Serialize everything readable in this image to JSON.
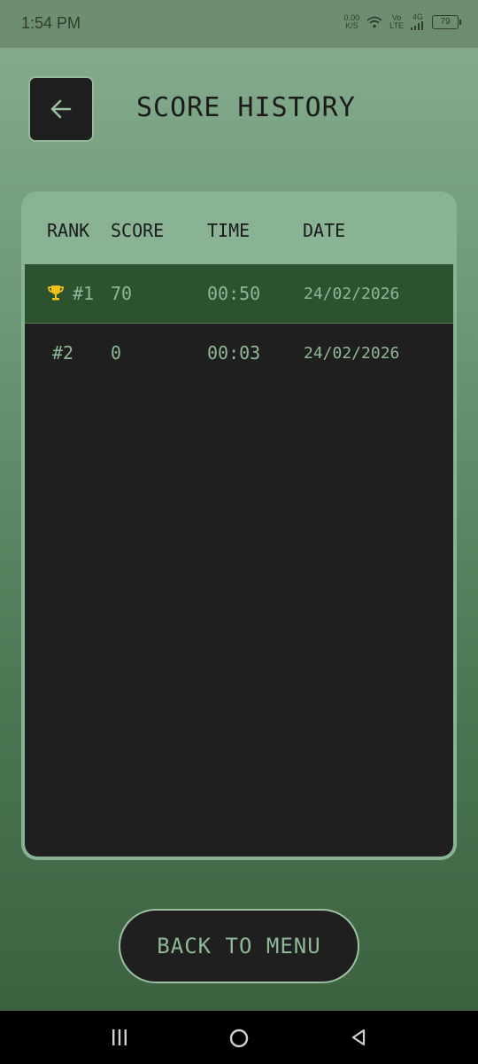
{
  "status_bar": {
    "time": "1:54 PM",
    "net_speed_value": "0.00",
    "net_speed_unit": "K/S",
    "volte_top": "Vo",
    "volte_bottom": "LTE",
    "network": "4G",
    "battery": "79"
  },
  "header": {
    "title": "SCORE HISTORY",
    "back_icon": "arrow-left-icon"
  },
  "table": {
    "columns": [
      "RANK",
      "SCORE",
      "TIME",
      "DATE"
    ],
    "rows": [
      {
        "rank": "#1",
        "score": "70",
        "time": "00:50",
        "date": "24/02/2026",
        "icon": "trophy-icon",
        "highlighted": true
      },
      {
        "rank": "#2",
        "score": "0",
        "time": "00:03",
        "date": "24/02/2026",
        "highlighted": false
      }
    ]
  },
  "back_to_menu_label": "BACK TO MENU",
  "nav_bar": {
    "icons": [
      "menu-icon",
      "home-icon",
      "back-triangle-icon"
    ]
  },
  "colors": {
    "accent_text": "#8fb896",
    "highlight_row": "#2d5230",
    "trophy": "#f2c21a",
    "dark_panel": "#1f1f1f"
  }
}
